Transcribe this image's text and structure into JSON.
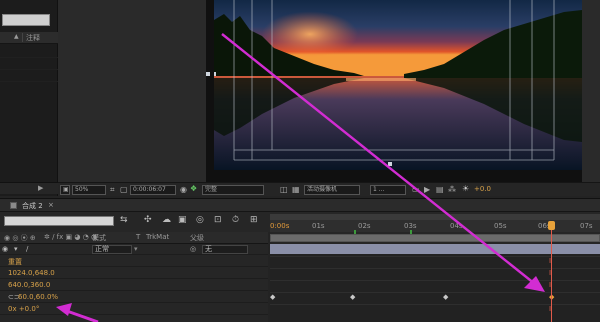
{
  "project_panel": {
    "notes_header": "注释"
  },
  "viewer_toolbar": {
    "zoom": "50%",
    "timecode": "0:00:06:07",
    "resolution": "完整",
    "camera": "活动摄像机",
    "views": "1 ...",
    "exposure": "+0.0"
  },
  "timeline": {
    "tab_label": "合成 2",
    "columns": {
      "mode": "模式",
      "t": "T",
      "trkmat": "TrkMat",
      "parent": "父级"
    },
    "layer": {
      "mode_value": "正常",
      "parent_value": "无"
    },
    "properties": [
      {
        "value": "重置"
      },
      {
        "value": "1024.0,648.0"
      },
      {
        "value": "640.0,360.0"
      },
      {
        "value": "60.0,60.0%"
      },
      {
        "value": "0x +0.0°"
      }
    ],
    "ruler_ticks": [
      "0:00s",
      "01s",
      "02s",
      "03s",
      "04s",
      "05s",
      "06s",
      "07s"
    ]
  },
  "colors": {
    "accent_orange": "#d8a24a",
    "annotation_magenta": "#d22cd2",
    "playhead_red": "#e05a4a"
  }
}
